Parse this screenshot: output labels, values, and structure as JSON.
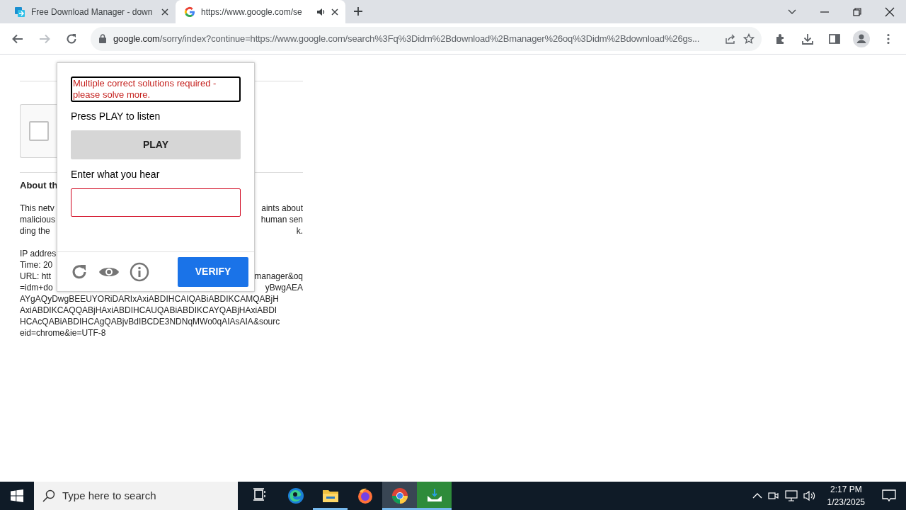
{
  "browser": {
    "tabs": [
      {
        "title": "Free Download Manager - down",
        "selected": false,
        "audio": false,
        "kind": "fdm"
      },
      {
        "title": "https://www.google.com/se",
        "selected": true,
        "audio": true,
        "kind": "google"
      }
    ],
    "address": {
      "domain": "google.com",
      "path": "/sorry/index?continue=https://www.google.com/search%3Fq%3Didm%2Bdownload%2Bmanager%26oq%3Didm%2Bdownload%26gs..."
    }
  },
  "page": {
    "recaptcha": {
      "checked": false
    },
    "heading": "About th",
    "paragraphs": [
      {
        "lines": [
          {
            "left": "This netv",
            "right": "aints about"
          },
          {
            "left": "malicious",
            "right": "human sen"
          },
          {
            "left": "ding the",
            "right": "k."
          }
        ]
      },
      {
        "lines": [
          {
            "left": "IP addres"
          },
          {
            "left": "Time: 20"
          },
          {
            "left": "URL: htt",
            "right": "manager&oq"
          },
          {
            "left": "=idm+do",
            "right": "yBwgAEA"
          },
          {
            "left": "AYgAQyDwgBEEUYORiDARIxAxiABDIHCAIQABiABDIKCAMQABjH"
          },
          {
            "left": "AxiABDIKCAQQABjHAxiABDIHCAUQABiABDIKCAYQABjHAxiABDI"
          },
          {
            "left": "HCAcQABiABDIHCAgQABjvBdIBCDE3NDNqMWo0qAIAsAIA&sourc"
          },
          {
            "left": "eid=chrome&ie=UTF-8"
          }
        ]
      }
    ]
  },
  "captcha": {
    "error": "Multiple correct solutions required - please solve more.",
    "listen_label": "Press PLAY to listen",
    "play": "PLAY",
    "answer_label": "Enter what you hear",
    "answer_invalid": true,
    "verify": "VERIFY"
  },
  "taskbar": {
    "search_placeholder": "Type here to search",
    "apps": [
      {
        "kind": "task-view",
        "selected": false,
        "running": false
      },
      {
        "kind": "edge",
        "selected": false,
        "running": false
      },
      {
        "kind": "explorer",
        "selected": false,
        "running": true
      },
      {
        "kind": "firefox",
        "selected": false,
        "running": false
      },
      {
        "kind": "chrome",
        "selected": true,
        "running": true
      },
      {
        "kind": "fdm",
        "selected": false,
        "running": true
      }
    ],
    "time": "2:17 PM",
    "date": "1/23/2025"
  }
}
